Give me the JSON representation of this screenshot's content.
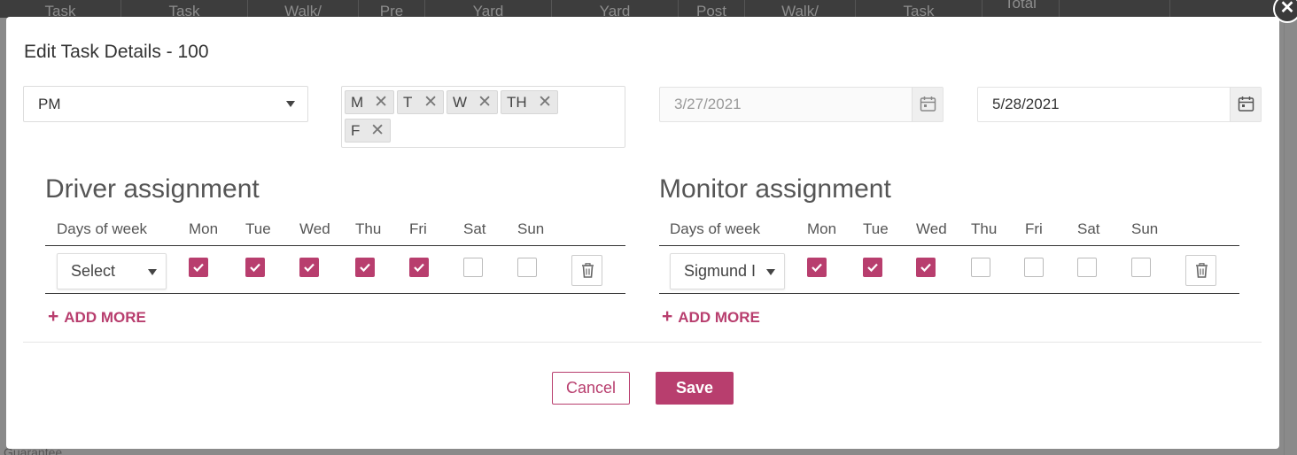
{
  "background": {
    "columns": [
      "Task",
      "Task",
      "Walk/",
      "Pre",
      "Yard",
      "Yard",
      "Post",
      "Walk/",
      "Task",
      "Total",
      "",
      ""
    ],
    "footer_text": "Guarantee"
  },
  "modal": {
    "title": "Edit Task Details - 100",
    "period": {
      "selected": "PM"
    },
    "days_tags": [
      "M",
      "T",
      "W",
      "TH",
      "F"
    ],
    "tag_remove_glyph": "✕",
    "start_date": "3/27/2021",
    "end_date": "5/28/2021",
    "driver": {
      "title": "Driver assignment",
      "headers": [
        "Days of week",
        "Mon",
        "Tue",
        "Wed",
        "Thu",
        "Fri",
        "Sat",
        "Sun"
      ],
      "row": {
        "select": "Select",
        "days": [
          true,
          true,
          true,
          true,
          true,
          false,
          false
        ]
      },
      "add_more": "ADD MORE"
    },
    "monitor": {
      "title": "Monitor assignment",
      "headers": [
        "Days of week",
        "Mon",
        "Tue",
        "Wed",
        "Thu",
        "Fri",
        "Sat",
        "Sun"
      ],
      "row": {
        "select": "Sigmund I",
        "days": [
          true,
          true,
          true,
          false,
          false,
          false,
          false
        ]
      },
      "add_more": "ADD MORE"
    },
    "buttons": {
      "cancel": "Cancel",
      "save": "Save"
    }
  },
  "icons": {
    "close": "close-icon",
    "calendar": "calendar-icon",
    "trash": "trash-icon",
    "check": "check-icon",
    "plus": "plus-icon"
  },
  "colors": {
    "accent": "#b83e6e",
    "backdrop": "#7a7a7a",
    "header": "#3d3d3d"
  }
}
